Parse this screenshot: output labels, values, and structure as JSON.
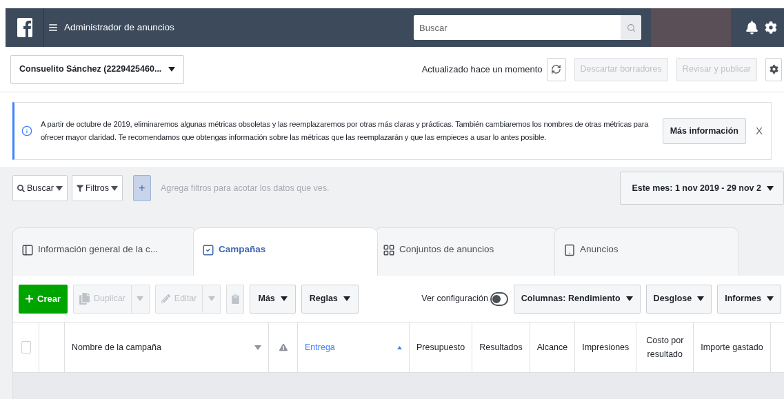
{
  "header": {
    "title": "Administrador de anuncios",
    "search": {
      "placeholder": "Buscar"
    }
  },
  "account": {
    "label": "Consuelito Sánchez (2229425460...",
    "updated": "Actualizado hace un momento",
    "buttons": [
      {
        "label": "Descartar borradores",
        "disabled": true
      },
      {
        "label": "Revisar y publicar",
        "disabled": true
      }
    ]
  },
  "notice": {
    "text": "A partir de octubre de 2019, eliminaremos algunas métricas obsoletas y las reemplazaremos por otras más claras y prácticas. También cambiaremos los nombres de otras métricas para ofrecer mayor claridad. Te recomendamos que obtengas información sobre las métricas que las reemplazarán y que las empieces a usar lo antes posible.",
    "button": "Más información",
    "close": "X"
  },
  "filters": {
    "search": "Buscar",
    "filter": "Filtros",
    "add": "+",
    "placeholder": "Agrega filtros para acotar los datos que ves.",
    "date": "Este mes: 1 nov 2019 - 29 nov 2"
  },
  "tabs": [
    {
      "label": "Información general de la c...",
      "selected": false,
      "kind": "overview"
    },
    {
      "label": "Campañas",
      "selected": true,
      "kind": "campaigns"
    },
    {
      "label": "Conjuntos de anuncios",
      "selected": false,
      "kind": "adsets"
    },
    {
      "label": "Anuncios",
      "selected": false,
      "kind": "ads"
    }
  ],
  "toolbar": {
    "create": "Crear",
    "actions": [
      {
        "label": "Duplicar",
        "disabled": true,
        "kind": "duplicate"
      },
      {
        "label": "Editar",
        "disabled": true,
        "kind": "edit"
      }
    ],
    "menus": [
      "Más",
      "Reglas"
    ],
    "view_settings": {
      "label": "Ver configuración",
      "on": false
    },
    "right_menus": [
      "Columnas: Rendimiento",
      "Desglose",
      "Informes"
    ]
  },
  "table": {
    "columns": [
      {
        "kind": "checkbox",
        "checked": false
      },
      {
        "kind": "blank"
      },
      {
        "kind": "text",
        "label": "Nombre de la campaña",
        "sorted": false
      },
      {
        "kind": "warning"
      },
      {
        "kind": "text",
        "label": "Entrega",
        "sorted": true
      },
      {
        "kind": "text",
        "label": "Presupuesto",
        "sorted": false
      },
      {
        "kind": "text",
        "label": "Resultados",
        "sorted": false
      },
      {
        "kind": "text",
        "label": "Alcance",
        "sorted": false
      },
      {
        "kind": "text",
        "label": "Impresiones",
        "sorted": false
      },
      {
        "kind": "text",
        "label": "Costo por resultado",
        "sorted": false
      },
      {
        "kind": "text",
        "label": "Importe gastado",
        "sorted": false
      }
    ]
  }
}
